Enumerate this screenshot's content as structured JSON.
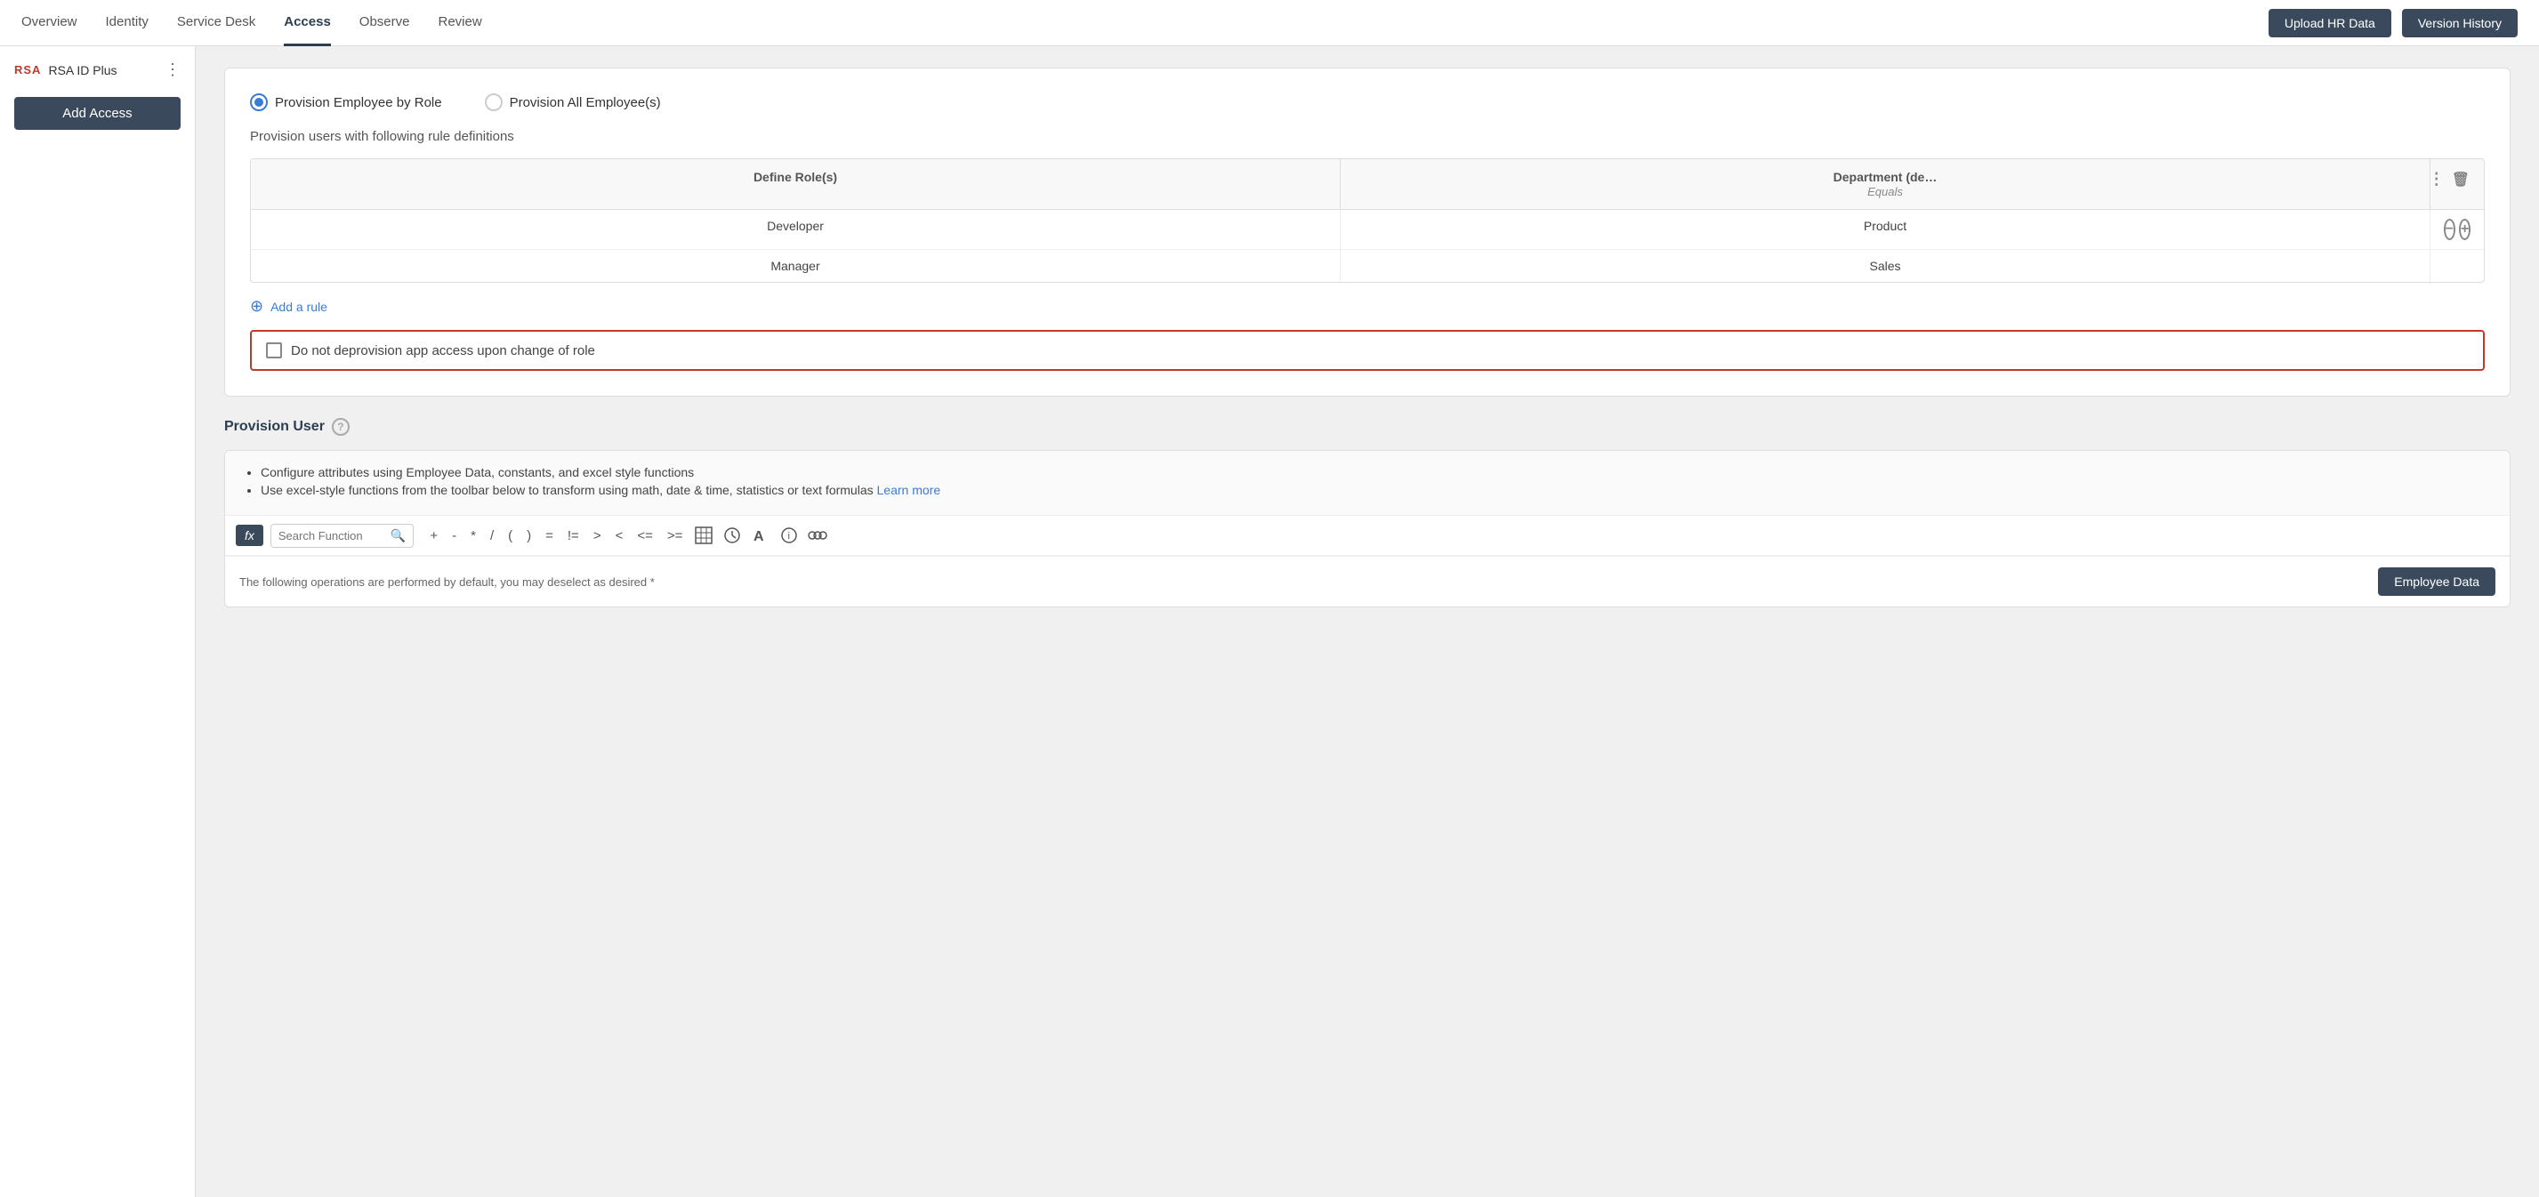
{
  "nav": {
    "items": [
      {
        "label": "Overview",
        "active": false
      },
      {
        "label": "Identity",
        "active": false
      },
      {
        "label": "Service Desk",
        "active": false
      },
      {
        "label": "Access",
        "active": true
      },
      {
        "label": "Observe",
        "active": false
      },
      {
        "label": "Review",
        "active": false
      }
    ],
    "upload_hr_data": "Upload HR Data",
    "version_history": "Version History"
  },
  "sidebar": {
    "logo": "RSA",
    "title": "RSA ID Plus",
    "add_access": "Add Access"
  },
  "provision_section": {
    "radio_option_1": "Provision Employee by Role",
    "radio_option_2": "Provision All Employee(s)",
    "rule_text": "Provision users with following rule definitions",
    "col_role": "Define Role(s)",
    "col_dept": "Department (de…",
    "col_dept_sub": "Equals",
    "rows": [
      {
        "role": "Developer",
        "dept": "Product"
      },
      {
        "role": "Manager",
        "dept": "Sales"
      }
    ],
    "add_rule": "Add a rule",
    "checkbox_label": "Do not deprovision app access upon change of role"
  },
  "provision_user": {
    "title": "Provision User",
    "bullet_1": "Configure attributes using Employee Data, constants, and excel style functions",
    "bullet_2": "Use excel-style functions from the toolbar below to transform using math, date & time, statistics or text formulas",
    "learn_more": "Learn more",
    "search_placeholder": "Search Function",
    "toolbar_ops": [
      "+",
      "-",
      "*",
      "/",
      "(",
      ")",
      "=",
      "!=",
      ">",
      "<",
      "<=",
      ">="
    ],
    "bottom_text": "The following operations are performed by default, you may deselect as desired *",
    "employee_data_btn": "Employee Data"
  }
}
